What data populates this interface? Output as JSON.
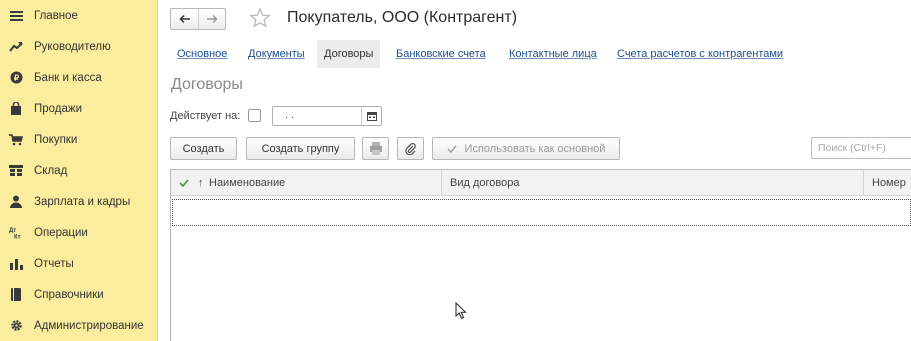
{
  "sidebar": {
    "items": [
      {
        "label": "Главное",
        "icon": "menu-lines-icon"
      },
      {
        "label": "Руководителю",
        "icon": "trend-chart-icon"
      },
      {
        "label": "Банк и касса",
        "icon": "coin-icon"
      },
      {
        "label": "Продажи",
        "icon": "shopping-bag-icon"
      },
      {
        "label": "Покупки",
        "icon": "shopping-cart-icon"
      },
      {
        "label": "Склад",
        "icon": "warehouse-icon"
      },
      {
        "label": "Зарплата и кадры",
        "icon": "person-icon"
      },
      {
        "label": "Операции",
        "icon": "operations-icon"
      },
      {
        "label": "Отчеты",
        "icon": "bar-chart-icon"
      },
      {
        "label": "Справочники",
        "icon": "book-icon"
      },
      {
        "label": "Администрирование",
        "icon": "gear-icon"
      }
    ]
  },
  "header": {
    "title": "Покупатель, ООО (Контрагент)"
  },
  "tabs": [
    {
      "label": "Основное"
    },
    {
      "label": "Документы"
    },
    {
      "label": "Договоры",
      "active": true
    },
    {
      "label": "Банковские счета"
    },
    {
      "label": "Контактные лица"
    },
    {
      "label": "Счета расчетов с контрагентами"
    }
  ],
  "section": {
    "title": "Договоры"
  },
  "filter": {
    "valid_on_label": "Действует на:",
    "date_value": " .  ."
  },
  "toolbar": {
    "create_label": "Создать",
    "create_group_label": "Создать группу",
    "use_as_main_label": "Использовать как основной",
    "search_placeholder": "Поиск (Ctrl+F)"
  },
  "table": {
    "columns": [
      {
        "label": "Наименование"
      },
      {
        "label": "Вид договора"
      },
      {
        "label": "Номер"
      }
    ],
    "sort_marker": "↑"
  },
  "colors": {
    "sidebar_bg": "#fbed9e",
    "link": "#1d4e89",
    "check_green": "#4a9a3a"
  }
}
